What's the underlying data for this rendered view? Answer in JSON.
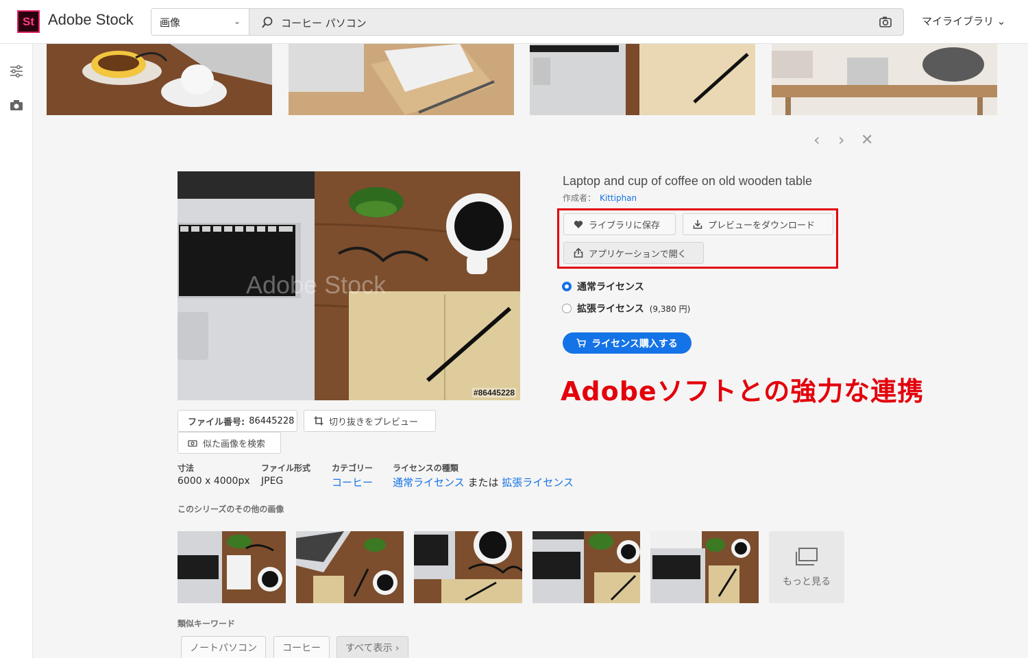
{
  "header": {
    "logo_text": "St",
    "app_title": "Adobe Stock",
    "type_select_value": "画像",
    "search_value": "コーヒー パソコン",
    "my_library": "マイライブラリ ⌄"
  },
  "detail": {
    "title": "Laptop and cup of coffee on old wooden table",
    "author_label": "作成者：",
    "author_name": "Kittiphan",
    "save_to_library": "ライブラリに保存",
    "download_preview": "プレビューをダウンロード",
    "open_in_app": "アプリケーションで開く",
    "license_standard": "通常ライセンス",
    "license_extended": "拡張ライセンス",
    "extended_price": "(9,380 円)",
    "buy_license": "ライセンス購入する",
    "annotation": "Adobeソフトとの強力な連携",
    "image_id_tag": "#86445228",
    "watermark": "Adobe Stock"
  },
  "file_info": {
    "file_number_label": "ファイル番号:",
    "file_number_value": "86445228",
    "crop_preview": "切り抜きをプレビュー",
    "find_similar": "似た画像を検索",
    "size_label": "寸法",
    "size_value": "6000 x 4000px",
    "format_label": "ファイル形式",
    "format_value": "JPEG",
    "category_label": "カテゴリー",
    "category_value": "コーヒー",
    "license_type_label": "ライセンスの種類",
    "license_standard_link": "通常ライセンス",
    "license_or": " または ",
    "license_extended_link": "拡張ライセンス"
  },
  "series": {
    "title": "このシリーズのその他の画像",
    "more_label": "もっと見る"
  },
  "keywords": {
    "title": "類似キーワード",
    "tags": [
      "ノートパソコン",
      "コーヒー"
    ],
    "show_all": "すべて表示 ›"
  },
  "colors": {
    "accent": "#1473e6",
    "annotation_red": "#e3000b",
    "wood": "#8a5a36"
  }
}
